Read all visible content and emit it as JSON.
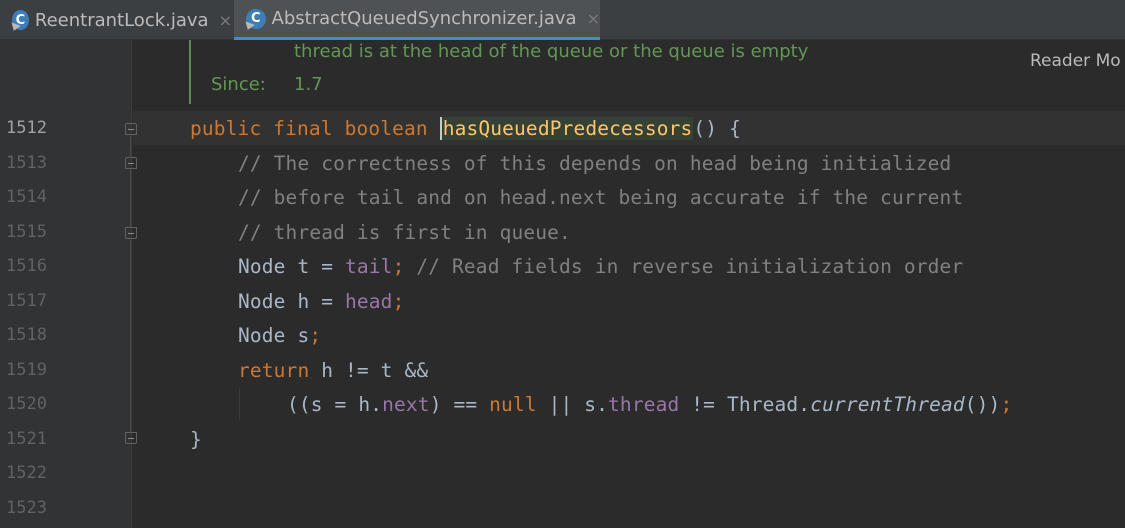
{
  "tabs": [
    {
      "label": "ReentrantLock.java",
      "icon": "class-icon",
      "icon_glyph": "C",
      "close": "×",
      "active": false
    },
    {
      "label": "AbstractQueuedSynchronizer.java",
      "icon": "class-icon",
      "icon_glyph": "C",
      "close": "×",
      "active": true
    }
  ],
  "doc": {
    "text_line": "thread is at the head of the queue or the queue is empty",
    "since_label": "Since:",
    "since_value": "1.7",
    "reader_mode": "Reader Mo"
  },
  "line_numbers": [
    "1512",
    "1513",
    "1514",
    "1515",
    "1516",
    "1517",
    "1518",
    "1519",
    "1520",
    "1521",
    "1522",
    "1523"
  ],
  "current_line": "1512",
  "code": {
    "l1512": {
      "kw1": "public",
      "kw2": "final",
      "kw3": "boolean",
      "method": "hasQueuedPredecessors",
      "rest": "() {"
    },
    "l1513": {
      "comment": "// The correctness of this depends on head being initialized"
    },
    "l1514": {
      "comment": "// before tail and on head.next being accurate if the current"
    },
    "l1515": {
      "comment": "// thread is first in queue."
    },
    "l1516": {
      "type": "Node",
      "var": "t",
      "eq": "=",
      "field": "tail",
      "semi": ";",
      "comment": "// Read fields in reverse initialization order"
    },
    "l1517": {
      "type": "Node",
      "var": "h",
      "eq": "=",
      "field": "head",
      "semi": ";"
    },
    "l1518": {
      "type": "Node",
      "var": "s",
      "semi": ";"
    },
    "l1519": {
      "kw": "return",
      "rest": "h != t &&"
    },
    "l1520": {
      "p1": "((s = h.",
      "field1": "next",
      "p2": ") == ",
      "kw": "null",
      "p3": " || s.",
      "field2": "thread",
      "p4": " != Thread.",
      "call": "currentThread",
      "p5": "())",
      "semi": ";"
    },
    "l1521": {
      "brace": "}"
    }
  }
}
